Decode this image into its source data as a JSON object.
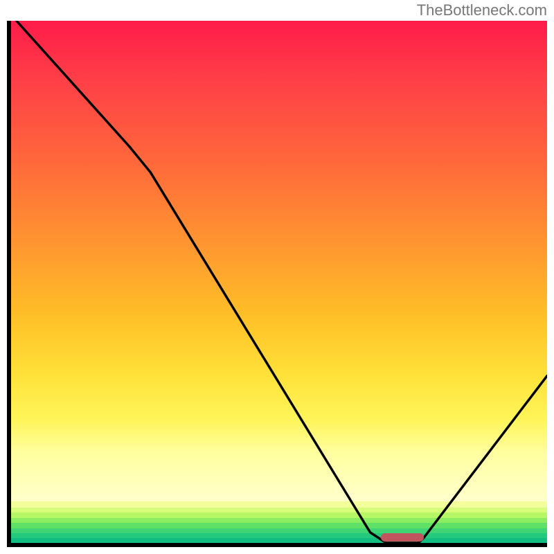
{
  "watermark": "TheBottleneck.com",
  "chart_data": {
    "type": "line",
    "title": "",
    "xlabel": "",
    "ylabel": "",
    "x_range": [
      0,
      100
    ],
    "y_range": [
      0,
      100
    ],
    "curve": [
      {
        "x": 1,
        "y": 100
      },
      {
        "x": 22,
        "y": 76
      },
      {
        "x": 26,
        "y": 71
      },
      {
        "x": 67,
        "y": 2
      },
      {
        "x": 70,
        "y": 0
      },
      {
        "x": 76,
        "y": 0
      },
      {
        "x": 77,
        "y": 1
      },
      {
        "x": 100,
        "y": 32
      }
    ],
    "marker": {
      "x_start": 69,
      "x_end": 77,
      "y": 0,
      "color": "#c0555e"
    },
    "gradient_stops": [
      {
        "y": 100,
        "color": "#ff1c49"
      },
      {
        "y": 88,
        "color": "#ff3e48"
      },
      {
        "y": 70,
        "color": "#ff6a3a"
      },
      {
        "y": 52,
        "color": "#ff9a2f"
      },
      {
        "y": 38,
        "color": "#ffc127"
      },
      {
        "y": 26,
        "color": "#ffe23a"
      },
      {
        "y": 17,
        "color": "#fff55a"
      },
      {
        "y": 10,
        "color": "#ffffa0"
      },
      {
        "y": 8,
        "color": "#ffffcc"
      },
      {
        "y": 7,
        "color": "#f3ff9a"
      },
      {
        "y": 6,
        "color": "#d8fd7a"
      },
      {
        "y": 5,
        "color": "#b6f766"
      },
      {
        "y": 4,
        "color": "#8aed5f"
      },
      {
        "y": 3,
        "color": "#5fe066"
      },
      {
        "y": 2,
        "color": "#3fd574"
      },
      {
        "y": 1,
        "color": "#24c97e"
      },
      {
        "y": 0,
        "color": "#12bd82"
      }
    ]
  }
}
